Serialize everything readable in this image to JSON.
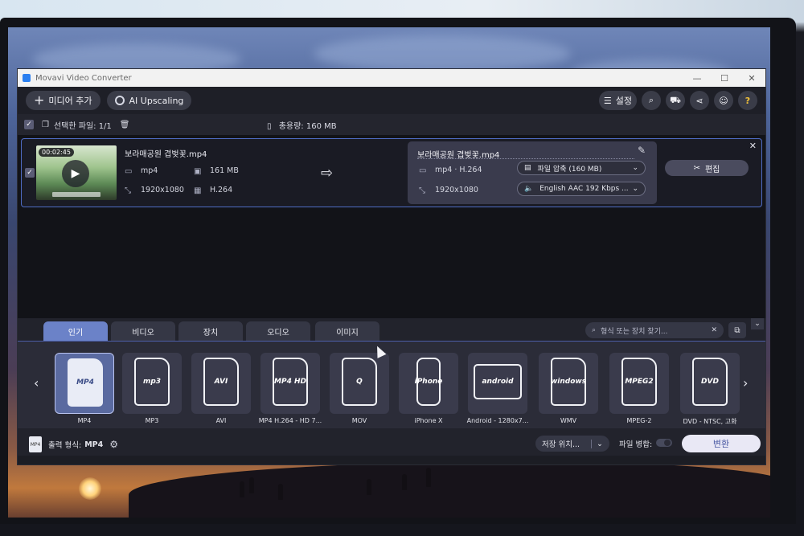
{
  "window": {
    "title": "Movavi Video Converter",
    "controls": [
      "—",
      "☐",
      "✕"
    ]
  },
  "toolbar": {
    "add_media_label": "미디어 추가",
    "ai_upscaling_label": "AI Upscaling",
    "settings_label": "설정"
  },
  "selection": {
    "selected_files_label": "선택한 파일: 1/1",
    "total_size_label": "총용량: 160 MB"
  },
  "file": {
    "duration": "00:02:45",
    "source_name": "보라매공원 겹벚꽃.mp4",
    "source_format": "mp4",
    "source_size": "161 MB",
    "source_resolution": "1920x1080",
    "source_codec": "H.264",
    "output_name": "보라매공원 겹벚꽃.mp4",
    "output_format": "mp4 · H.264",
    "output_resolution": "1920x1080",
    "compression_label": "파일 압축 (160 MB)",
    "audio_label": "English AAC 192 Kbps ...",
    "edit_label": "편집"
  },
  "tabs": [
    "인기",
    "비디오",
    "장치",
    "오디오",
    "이미지"
  ],
  "active_tab": "인기",
  "search": {
    "placeholder": "형식 또는 장치 찾기..."
  },
  "formats": [
    {
      "icon": "MP4",
      "label": "MP4",
      "active": true
    },
    {
      "icon": "mp3",
      "label": "MP3",
      "active": false
    },
    {
      "icon": "AVI",
      "label": "AVI",
      "active": false
    },
    {
      "icon": "MP4 HD",
      "label": "MP4 H.264 - HD 7...",
      "active": false
    },
    {
      "icon": "Q",
      "label": "MOV",
      "active": false
    },
    {
      "icon": "iPhone",
      "label": "iPhone X",
      "active": false
    },
    {
      "icon": "android",
      "label": "Android - 1280x7...",
      "active": false
    },
    {
      "icon": "windows",
      "label": "WMV",
      "active": false
    },
    {
      "icon": "MPEG2",
      "label": "MPEG-2",
      "active": false
    },
    {
      "icon": "DVD",
      "label": "DVD - NTSC, 고화",
      "active": false
    }
  ],
  "bottom": {
    "output_format_label": "출력 형식:",
    "output_format_value": "MP4",
    "save_location_label": "저장 위치...",
    "merge_label": "파일 병합:",
    "convert_label": "변환"
  }
}
